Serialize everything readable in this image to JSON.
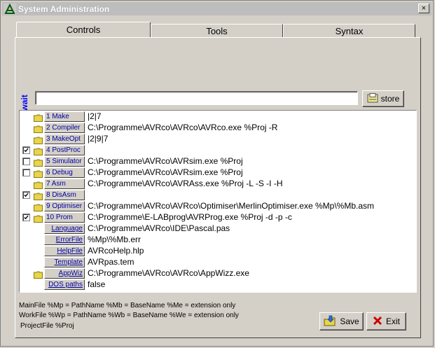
{
  "window": {
    "title": "System Administration",
    "close_label": "×"
  },
  "tabs": [
    {
      "label": "Controls",
      "active": true
    },
    {
      "label": "Tools",
      "active": false
    },
    {
      "label": "Syntax",
      "active": false
    }
  ],
  "exec_wait_label": "<Exec & wait",
  "command_input": {
    "value": ""
  },
  "store_button": {
    "label": "store",
    "icon": "store-icon"
  },
  "items": [
    {
      "name": "1 Make",
      "value": "|2|7",
      "checkbox": false,
      "checked": false,
      "folder": true
    },
    {
      "name": "2 Compiler",
      "value": "C:\\Programme\\AVRco\\AVRco\\AVRco.exe %Proj -R",
      "checkbox": false,
      "checked": false,
      "folder": true
    },
    {
      "name": "3 MakeOpt",
      "value": "|2|9|7",
      "checkbox": false,
      "checked": false,
      "folder": true
    },
    {
      "name": "4 PostProc",
      "value": "",
      "checkbox": true,
      "checked": true,
      "folder": true
    },
    {
      "name": "5 Simulator",
      "value": "C:\\Programme\\AVRco\\AVRsim.exe %Proj",
      "checkbox": true,
      "checked": false,
      "folder": true
    },
    {
      "name": "6 Debug",
      "value": "C:\\Programme\\AVRco\\AVRsim.exe %Proj",
      "checkbox": true,
      "checked": false,
      "folder": true
    },
    {
      "name": "7 Asm",
      "value": "C:\\Programme\\AVRco\\AVRAss.exe %Proj -L -S -I -H",
      "checkbox": false,
      "checked": false,
      "folder": true
    },
    {
      "name": "8 DisAsm",
      "value": "",
      "checkbox": true,
      "checked": true,
      "folder": true
    },
    {
      "name": "9 Optimiser",
      "value": "C:\\Programme\\AVRco\\AVRco\\Optimiser\\MerlinOptimiser.exe %Mp\\%Mb.asm",
      "checkbox": false,
      "checked": false,
      "folder": true
    },
    {
      "name": "10 Prom",
      "value": "C:\\Programme\\E-LABprog\\AVRProg.exe %Proj -d -p -c",
      "checkbox": true,
      "checked": true,
      "folder": true
    },
    {
      "name": "Language",
      "value": "C:\\Programme\\AVRco\\IDE\\Pascal.pas",
      "checkbox": false,
      "checked": false,
      "folder": false
    },
    {
      "name": "ErrorFile",
      "value": "%Mp\\%Mb.err",
      "checkbox": false,
      "checked": false,
      "folder": false
    },
    {
      "name": "HelpFile",
      "value": "AVRcoHelp.hlp",
      "checkbox": false,
      "checked": false,
      "folder": false
    },
    {
      "name": "Template",
      "value": "AVRpas.tem",
      "checkbox": false,
      "checked": false,
      "folder": false
    },
    {
      "name": "AppWiz",
      "value": "C:\\Programme\\AVRco\\AVRco\\AppWizz.exe",
      "checkbox": false,
      "checked": false,
      "folder": true
    },
    {
      "name": "DOS paths",
      "value": "false",
      "checkbox": false,
      "checked": false,
      "folder": false
    }
  ],
  "footer": {
    "line1": "MainFile %Mp = PathName  %Mb = BaseName  %Me = extension only",
    "line2": "WorkFile %Wp = PathName  %Wb = BaseName  %We = extension only",
    "line3": "ProjectFile %Proj"
  },
  "save_button": {
    "label": "Save",
    "icon": "save-icon"
  },
  "exit_button": {
    "label": "Exit",
    "icon": "exit-x-icon"
  },
  "colors": {
    "accent": "#0000ff",
    "link": "#0000a0",
    "folder": "#e8d44d",
    "exit": "#cc0000"
  }
}
